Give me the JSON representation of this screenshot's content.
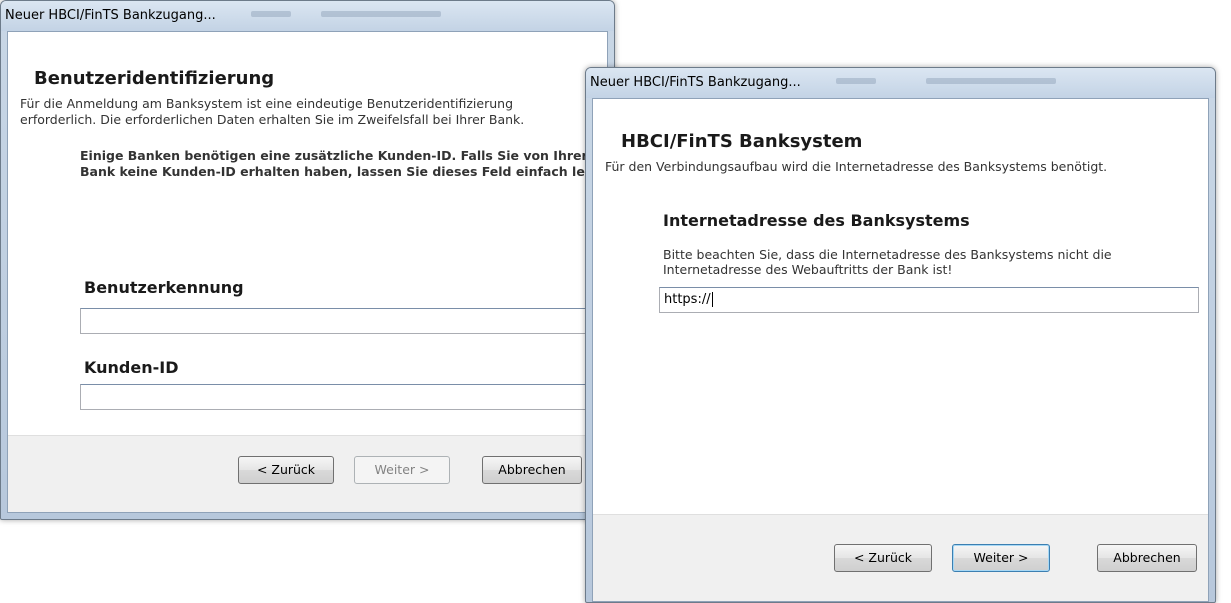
{
  "dialog_left": {
    "window_title": "Neuer HBCI/FinTS Bankzugang...",
    "heading": "Benutzeridentifizierung",
    "description_line1": "Für die Anmeldung am Banksystem ist eine eindeutige Benutzeridentifizierung",
    "description_line2": "erforderlich. Die erforderlichen Daten erhalten Sie im Zweifelsfall bei Ihrer Bank.",
    "note_line1": "Einige Banken benötigen eine zusätzliche Kunden-ID. Falls Sie von Ihrer",
    "note_line2": "Bank keine Kunden-ID erhalten haben, lassen Sie dieses Feld einfach leer.",
    "field_user_label": "Benutzerkennung",
    "field_user_value": "",
    "field_customer_label": "Kunden-ID",
    "field_customer_value": "",
    "back_button": "< Zurück",
    "next_button": "Weiter >",
    "cancel_button": "Abbrechen"
  },
  "dialog_right": {
    "window_title": "Neuer HBCI/FinTS Bankzugang...",
    "heading": "HBCI/FinTS Banksystem",
    "description": "Für den Verbindungsaufbau wird die Internetadresse des Banksystems benötigt.",
    "section_label": "Internetadresse des Banksystems",
    "hint_line1": "Bitte beachten Sie, dass die Internetadresse des Banksystems nicht die",
    "hint_line2": "Internetadresse des Webauftritts der Bank ist!",
    "url_value": "https://",
    "back_button": "< Zurück",
    "next_button": "Weiter >",
    "cancel_button": "Abbrechen"
  }
}
